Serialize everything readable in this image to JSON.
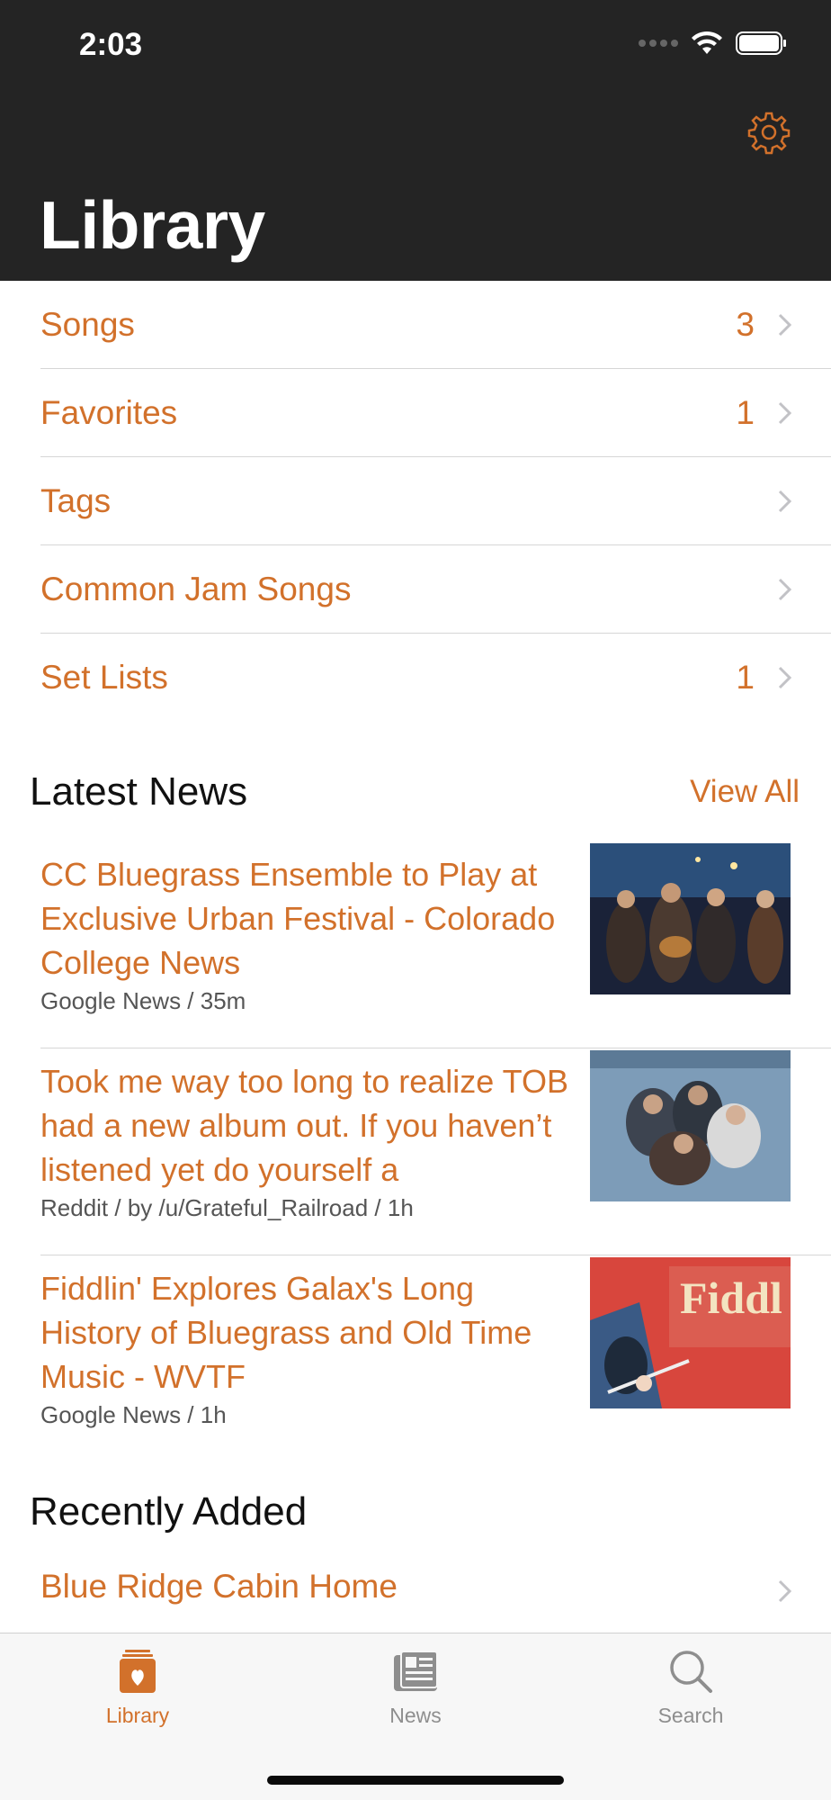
{
  "status_bar": {
    "time": "2:03"
  },
  "header": {
    "title": "Library",
    "settings_icon": "gear-icon"
  },
  "library": [
    {
      "label": "Songs",
      "count": "3"
    },
    {
      "label": "Favorites",
      "count": "1"
    },
    {
      "label": "Tags",
      "count": ""
    },
    {
      "label": "Common Jam Songs",
      "count": ""
    },
    {
      "label": "Set Lists",
      "count": "1"
    }
  ],
  "latest_news": {
    "title": "Latest News",
    "view_all": "View All",
    "items": [
      {
        "title": "CC Bluegrass Ensemble to Play at Exclusive Urban Festival - Colorado College News",
        "meta": "Google News / 35m"
      },
      {
        "title": "Took me way too long to realize TOB had a new album out. If you haven’t listened yet do yourself a",
        "meta": "Reddit / by /u/Grateful_Railroad / 1h"
      },
      {
        "title": "Fiddlin' Explores Galax's Long History of Bluegrass and Old Time Music - WVTF",
        "meta": "Google News / 1h"
      }
    ]
  },
  "recently_added": {
    "title": "Recently Added",
    "items": [
      {
        "label": "Blue Ridge Cabin Home"
      }
    ]
  },
  "tabbar": {
    "tabs": [
      {
        "label": "Library",
        "icon": "library-icon",
        "active": true
      },
      {
        "label": "News",
        "icon": "news-icon",
        "active": false
      },
      {
        "label": "Search",
        "icon": "search-icon",
        "active": false
      }
    ]
  },
  "colors": {
    "accent": "#d2712b",
    "header_bg": "#242424"
  }
}
